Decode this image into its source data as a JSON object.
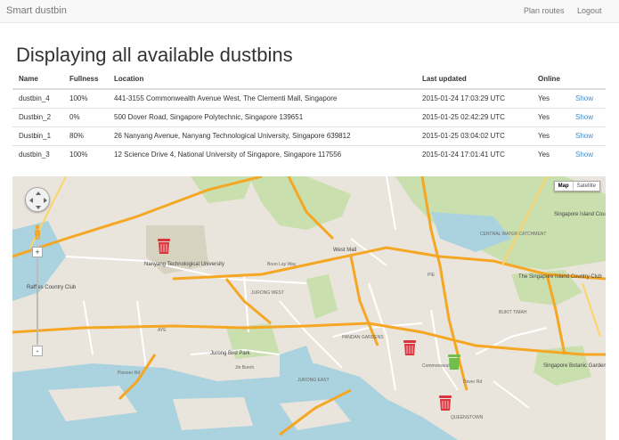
{
  "navbar": {
    "brand": "Smart dustbin",
    "links": [
      "Plan routes",
      "Logout"
    ]
  },
  "page": {
    "title": "Displaying all available dustbins"
  },
  "table": {
    "headers": [
      "Name",
      "Fullness",
      "Location",
      "Last updated",
      "Online"
    ],
    "rows": [
      {
        "name": "dustbin_4",
        "fullness": "100%",
        "location": "441-3155 Commonwealth Avenue West, The Clementi Mall, Singapore",
        "updated": "2015-01-24 17:03:29 UTC",
        "online": "Yes",
        "action": "Show"
      },
      {
        "name": "Dustbin_2",
        "fullness": "0%",
        "location": "500 Dover Road, Singapore Polytechnic, Singapore 139651",
        "updated": "2015-01-25 02:42:29 UTC",
        "online": "Yes",
        "action": "Show"
      },
      {
        "name": "Dustbin_1",
        "fullness": "80%",
        "location": "26 Nanyang Avenue, Nanyang Technological University, Singapore 639812",
        "updated": "2015-01-25 03:04:02 UTC",
        "online": "Yes",
        "action": "Show"
      },
      {
        "name": "dustbin_3",
        "fullness": "100%",
        "location": "12 Science Drive 4, National University of Singapore, Singapore 117556",
        "updated": "2015-01-24 17:01:41 UTC",
        "online": "Yes",
        "action": "Show"
      }
    ]
  },
  "map": {
    "type_buttons": [
      "Map",
      "Satellite"
    ],
    "zoom_in": "+",
    "zoom_out": "-",
    "labels": {
      "nanyang_tech": "Nanyang Technological University",
      "raffles_cc": "Raffles Country Club",
      "west_mall": "West Mall",
      "jurong_west": "JURONG WEST",
      "jurong_east": "JURONG EAST",
      "jurong_bird_park": "Jurong Bird Park",
      "pandan_gardens": "PANDAN GARDENS",
      "central_catchment": "CENTRAL WATER CATCHMENT",
      "singapore_island_cc_n": "Singapore Island Country Club",
      "singapore_island_cc_s": "The Singapore Island Country Club",
      "bukit_timah": "BUKIT TIMAH",
      "botanic_gardens": "Singapore Botanic Gardens",
      "queenstown": "QUEENSTOWN",
      "commonwealth": "Commonwealth",
      "pie": "PIE",
      "aye": "AYE",
      "boon_lay_way": "Boon Lay Way",
      "pioneer_rd": "Pioneer Rd",
      "jln_buroh": "Jln Buroh",
      "dover_rd": "Dover Rd"
    },
    "markers": [
      {
        "name": "marker-nanyang",
        "color": "#d9363e"
      },
      {
        "name": "marker-clementi",
        "color": "#d9363e"
      },
      {
        "name": "marker-dover",
        "color": "#6fbf4a"
      },
      {
        "name": "marker-nus",
        "color": "#d9363e"
      }
    ]
  }
}
